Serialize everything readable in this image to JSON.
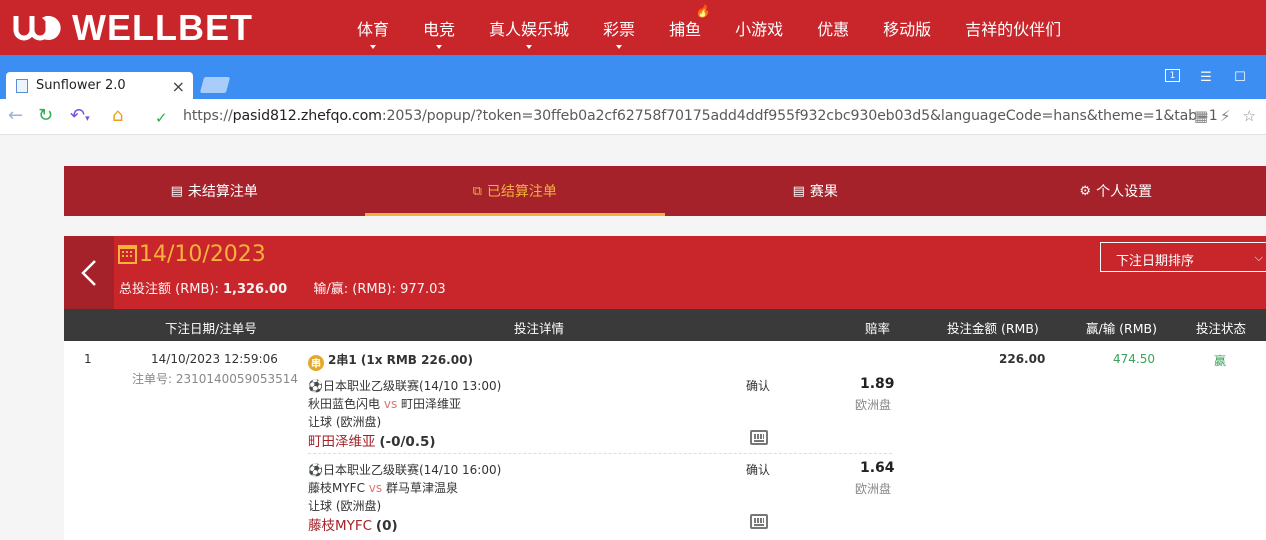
{
  "site": {
    "logo_text": "WELLBET",
    "nav": [
      {
        "label": "体育",
        "caret": true
      },
      {
        "label": "电竞",
        "caret": true
      },
      {
        "label": "真人娱乐城",
        "caret": true
      },
      {
        "label": "彩票",
        "caret": true
      },
      {
        "label": "捕鱼",
        "caret": false,
        "hot": true
      },
      {
        "label": "小游戏",
        "caret": false
      },
      {
        "label": "优惠",
        "caret": false
      },
      {
        "label": "移动版",
        "caret": false
      },
      {
        "label": "吉祥的伙伴们",
        "caret": false
      }
    ]
  },
  "browser": {
    "tab_title": "Sunflower 2.0",
    "window_badge": "1",
    "url_prefix": "https://",
    "url_host": "pasid812.zhefqo.com",
    "url_rest": ":2053/popup/?token=30ffeb0a2cf62758f70175add4ddf955f932cbc930eb03d5&languageCode=hans&theme=1&tab=1"
  },
  "tabs": [
    {
      "label": "未结算注单",
      "icon": "document-icon"
    },
    {
      "label": "已结算注单",
      "icon": "copy-icon",
      "active": true
    },
    {
      "label": "赛果",
      "icon": "scoreboard-icon"
    },
    {
      "label": "个人设置",
      "icon": "gear-icon"
    }
  ],
  "summary": {
    "date": "14/10/2023",
    "total_stake_label": "总投注额 (RMB):",
    "total_stake_value": "1,326.00",
    "winloss_label": "输/赢: (RMB):",
    "winloss_value": "977.03",
    "sort_label": "下注日期排序"
  },
  "table": {
    "headers": {
      "date": "下注日期/注单号",
      "detail": "投注详情",
      "odds": "赔率",
      "stake": "投注金额 (RMB)",
      "winloss": "赢/输 (RMB)",
      "status": "投注状态"
    },
    "row": {
      "index": "1",
      "datetime": "14/10/2023 12:59:06",
      "bet_no": "注单号: 2310140059053514",
      "parlay_badge": "串",
      "parlay": "2串1 (1x RMB 226.00)",
      "stake": "226.00",
      "winloss": "474.50",
      "status": "赢",
      "legs": [
        {
          "league": "日本职业乙级联赛(14/10 13:00)",
          "home": "秋田蓝色闪电",
          "vs": "vs",
          "away": "町田泽维亚",
          "market": "让球 (欧洲盘)",
          "pick": "町田泽维亚",
          "handicap": "(-0/0.5)",
          "confirm": "确认",
          "odds": "1.89",
          "odds_type": "欧洲盘"
        },
        {
          "league": "日本职业乙级联赛(14/10 16:00)",
          "home": "藤枝MYFC",
          "vs": "vs",
          "away": "群马草津温泉",
          "market": "让球 (欧洲盘)",
          "pick": "藤枝MYFC",
          "handicap": "(0)",
          "confirm": "确认",
          "odds": "1.64",
          "odds_type": "欧洲盘"
        }
      ]
    }
  },
  "colors": {
    "brand_red": "#c8262b",
    "dark_red": "#a5222a",
    "accent_gold": "#f2b13c",
    "browser_blue": "#3c8ef2",
    "win_green": "#3aa35a"
  }
}
